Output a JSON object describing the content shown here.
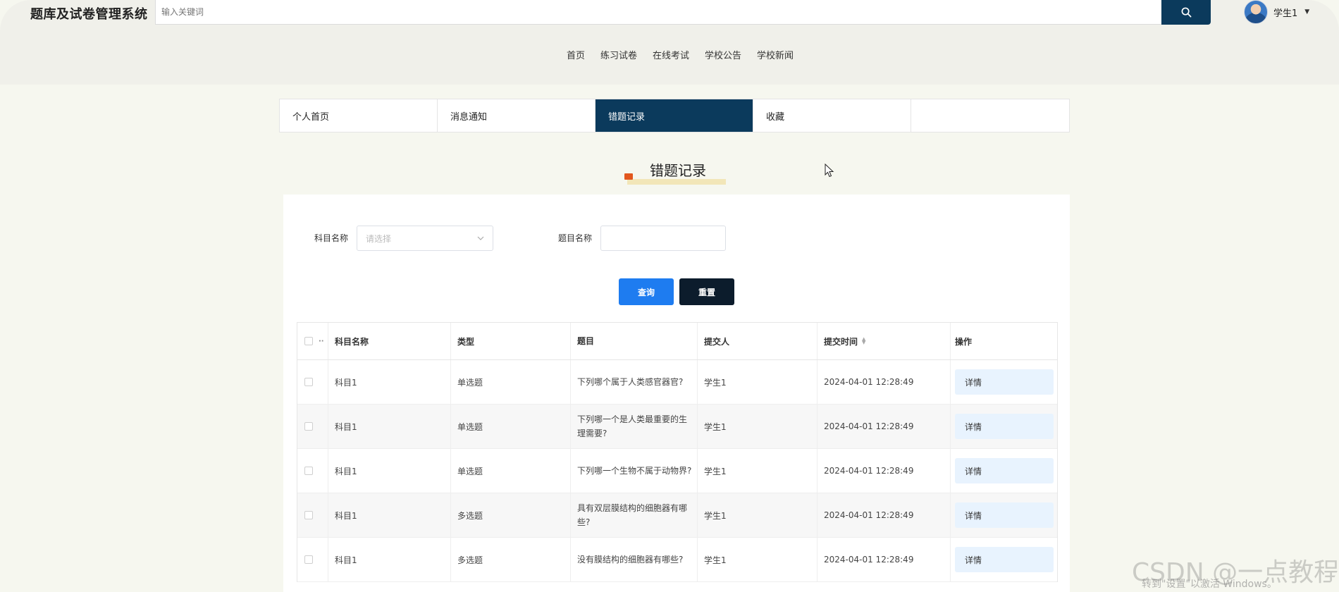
{
  "app": {
    "title": "题库及试卷管理系统"
  },
  "search": {
    "placeholder": "输入关键词",
    "button_icon": "search-icon"
  },
  "user": {
    "name": "学生1",
    "avatar_icon": "avatar-icon"
  },
  "main_nav": [
    "首页",
    "练习试卷",
    "在线考试",
    "学校公告",
    "学校新闻"
  ],
  "tabs": [
    {
      "label": "个人首页",
      "active": false
    },
    {
      "label": "消息通知",
      "active": false
    },
    {
      "label": "错题记录",
      "active": true
    },
    {
      "label": "收藏",
      "active": false
    }
  ],
  "section": {
    "title": "错题记录"
  },
  "filters": {
    "subject_label": "科目名称",
    "subject_placeholder": "请选择",
    "question_label": "题目名称",
    "question_value": ""
  },
  "buttons": {
    "query": "查询",
    "reset": "重置"
  },
  "table": {
    "headers": {
      "subject": "科目名称",
      "type": "类型",
      "question": "题目",
      "submitter": "提交人",
      "time": "提交时间",
      "action": "操作"
    },
    "rows": [
      {
        "subject": "科目1",
        "type": "单选题",
        "question": "下列哪个属于人类感官器官?",
        "submitter": "学生1",
        "time": "2024-04-01 12:28:49",
        "action": "详情"
      },
      {
        "subject": "科目1",
        "type": "单选题",
        "question": "下列哪一个是人类最重要的生理需要?",
        "submitter": "学生1",
        "time": "2024-04-01 12:28:49",
        "action": "详情"
      },
      {
        "subject": "科目1",
        "type": "单选题",
        "question": "下列哪一个生物不属于动物界?",
        "submitter": "学生1",
        "time": "2024-04-01 12:28:49",
        "action": "详情"
      },
      {
        "subject": "科目1",
        "type": "多选题",
        "question": "具有双层膜结构的细胞器有哪些?",
        "submitter": "学生1",
        "time": "2024-04-01 12:28:49",
        "action": "详情"
      },
      {
        "subject": "科目1",
        "type": "多选题",
        "question": "没有膜结构的细胞器有哪些?",
        "submitter": "学生1",
        "time": "2024-04-01 12:28:49",
        "action": "详情"
      }
    ]
  },
  "watermark": {
    "text": "CSDN @一点教程",
    "activate_text": "转到\"设置\"以激活 Windows。"
  },
  "colors": {
    "primary_dark": "#0b3a5c",
    "query_blue": "#1e7cf0",
    "reset_dark": "#0c1c2c",
    "detail_bg": "#e8f3fe"
  }
}
